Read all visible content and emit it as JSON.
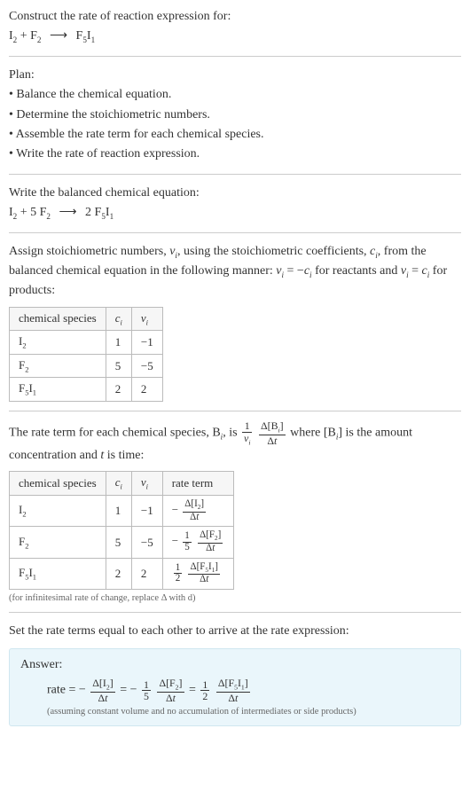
{
  "prompt": {
    "line1": "Construct the rate of reaction expression for:",
    "eq_lhs1": "I",
    "eq_lhs1_sub": "2",
    "plus1": " + ",
    "eq_lhs2": "F",
    "eq_lhs2_sub": "2",
    "arrow": "⟶",
    "eq_rhs1": "F",
    "eq_rhs1_sub1": "5",
    "eq_rhs1b": "I",
    "eq_rhs1_sub2": "1"
  },
  "plan": {
    "title": "Plan:",
    "b1": "• Balance the chemical equation.",
    "b2": "• Determine the stoichiometric numbers.",
    "b3": "• Assemble the rate term for each chemical species.",
    "b4": "• Write the rate of reaction expression."
  },
  "balanced": {
    "title": "Write the balanced chemical equation:",
    "I": "I",
    "I_sub": "2",
    "plus": " + 5 ",
    "F": "F",
    "F_sub": "2",
    "arrow": "⟶",
    "two": " 2 ",
    "P1": "F",
    "P1_sub": "5",
    "P2": "I",
    "P2_sub": "1"
  },
  "assign": {
    "text_a": "Assign stoichiometric numbers, ",
    "nu": "ν",
    "nu_sub": "i",
    "text_b": ", using the stoichiometric coefficients, ",
    "c": "c",
    "c_sub": "i",
    "text_c": ", from the balanced chemical equation in the following manner: ",
    "rel_react_lhs": "ν",
    "rel_react_lhs_sub": "i",
    "rel_react_eq": " = −",
    "rel_react_rhs": "c",
    "rel_react_rhs_sub": "i",
    "text_d": " for reactants and ",
    "rel_prod_lhs": "ν",
    "rel_prod_lhs_sub": "i",
    "rel_prod_eq": " = ",
    "rel_prod_rhs": "c",
    "rel_prod_rhs_sub": "i",
    "text_e": " for products:"
  },
  "table1": {
    "h1": "chemical species",
    "h2": "c",
    "h2_sub": "i",
    "h3": "ν",
    "h3_sub": "i",
    "rows": [
      {
        "sp_a": "I",
        "sp_asub": "2",
        "sp_b": "",
        "sp_bsub": "",
        "c": "1",
        "nu": "−1"
      },
      {
        "sp_a": "F",
        "sp_asub": "2",
        "sp_b": "",
        "sp_bsub": "",
        "c": "5",
        "nu": "−5"
      },
      {
        "sp_a": "F",
        "sp_asub": "5",
        "sp_b": "I",
        "sp_bsub": "1",
        "c": "2",
        "nu": "2"
      }
    ]
  },
  "rateterm": {
    "t1": "The rate term for each chemical species, B",
    "t1_sub": "i",
    "t2": ", is ",
    "one": "1",
    "nu": "ν",
    "nu_sub": "i",
    "dB": "Δ[B",
    "dB_sub": "i",
    "dB_close": "]",
    "dt": "Δt",
    "t3": " where [B",
    "t3_sub": "i",
    "t3b": "] is the amount concentration and ",
    "t_var": "t",
    "t4": " is time:"
  },
  "table2": {
    "h1": "chemical species",
    "h2": "c",
    "h2_sub": "i",
    "h3": "ν",
    "h3_sub": "i",
    "h4": "rate term",
    "rows": [
      {
        "sp_a": "I",
        "sp_asub": "2",
        "sp_b": "",
        "sp_bsub": "",
        "c": "1",
        "nu": "−1",
        "neg": "−",
        "fnum": "",
        "fden": "",
        "dnum": "Δ[I",
        "dnum_sub": "2",
        "dnum_close": "]",
        "dden": "Δt"
      },
      {
        "sp_a": "F",
        "sp_asub": "2",
        "sp_b": "",
        "sp_bsub": "",
        "c": "5",
        "nu": "−5",
        "neg": "−",
        "fnum": "1",
        "fden": "5",
        "dnum": "Δ[F",
        "dnum_sub": "2",
        "dnum_close": "]",
        "dden": "Δt"
      },
      {
        "sp_a": "F",
        "sp_asub": "5",
        "sp_b": "I",
        "sp_bsub": "1",
        "c": "2",
        "nu": "2",
        "neg": "",
        "fnum": "1",
        "fden": "2",
        "dnum": "Δ[F",
        "dnum_sub": "5",
        "dnum_mid": "I",
        "dnum_sub2": "1",
        "dnum_close": "]",
        "dden": "Δt"
      }
    ],
    "note": "(for infinitesimal rate of change, replace Δ with d)"
  },
  "setrate": "Set the rate terms equal to each other to arrive at the rate expression:",
  "answer": {
    "title": "Answer:",
    "lead": "rate = −",
    "t1_num": "Δ[I",
    "t1_sub": "2",
    "t1_close": "]",
    "t1_den": "Δt",
    "eq1": " = −",
    "f2_num": "1",
    "f2_den": "5",
    "t2_num": "Δ[F",
    "t2_sub": "2",
    "t2_close": "]",
    "t2_den": "Δt",
    "eq2": " = ",
    "f3_num": "1",
    "f3_den": "2",
    "t3_num": "Δ[F",
    "t3_sub1": "5",
    "t3_mid": "I",
    "t3_sub2": "1",
    "t3_close": "]",
    "t3_den": "Δt",
    "note": "(assuming constant volume and no accumulation of intermediates or side products)"
  }
}
